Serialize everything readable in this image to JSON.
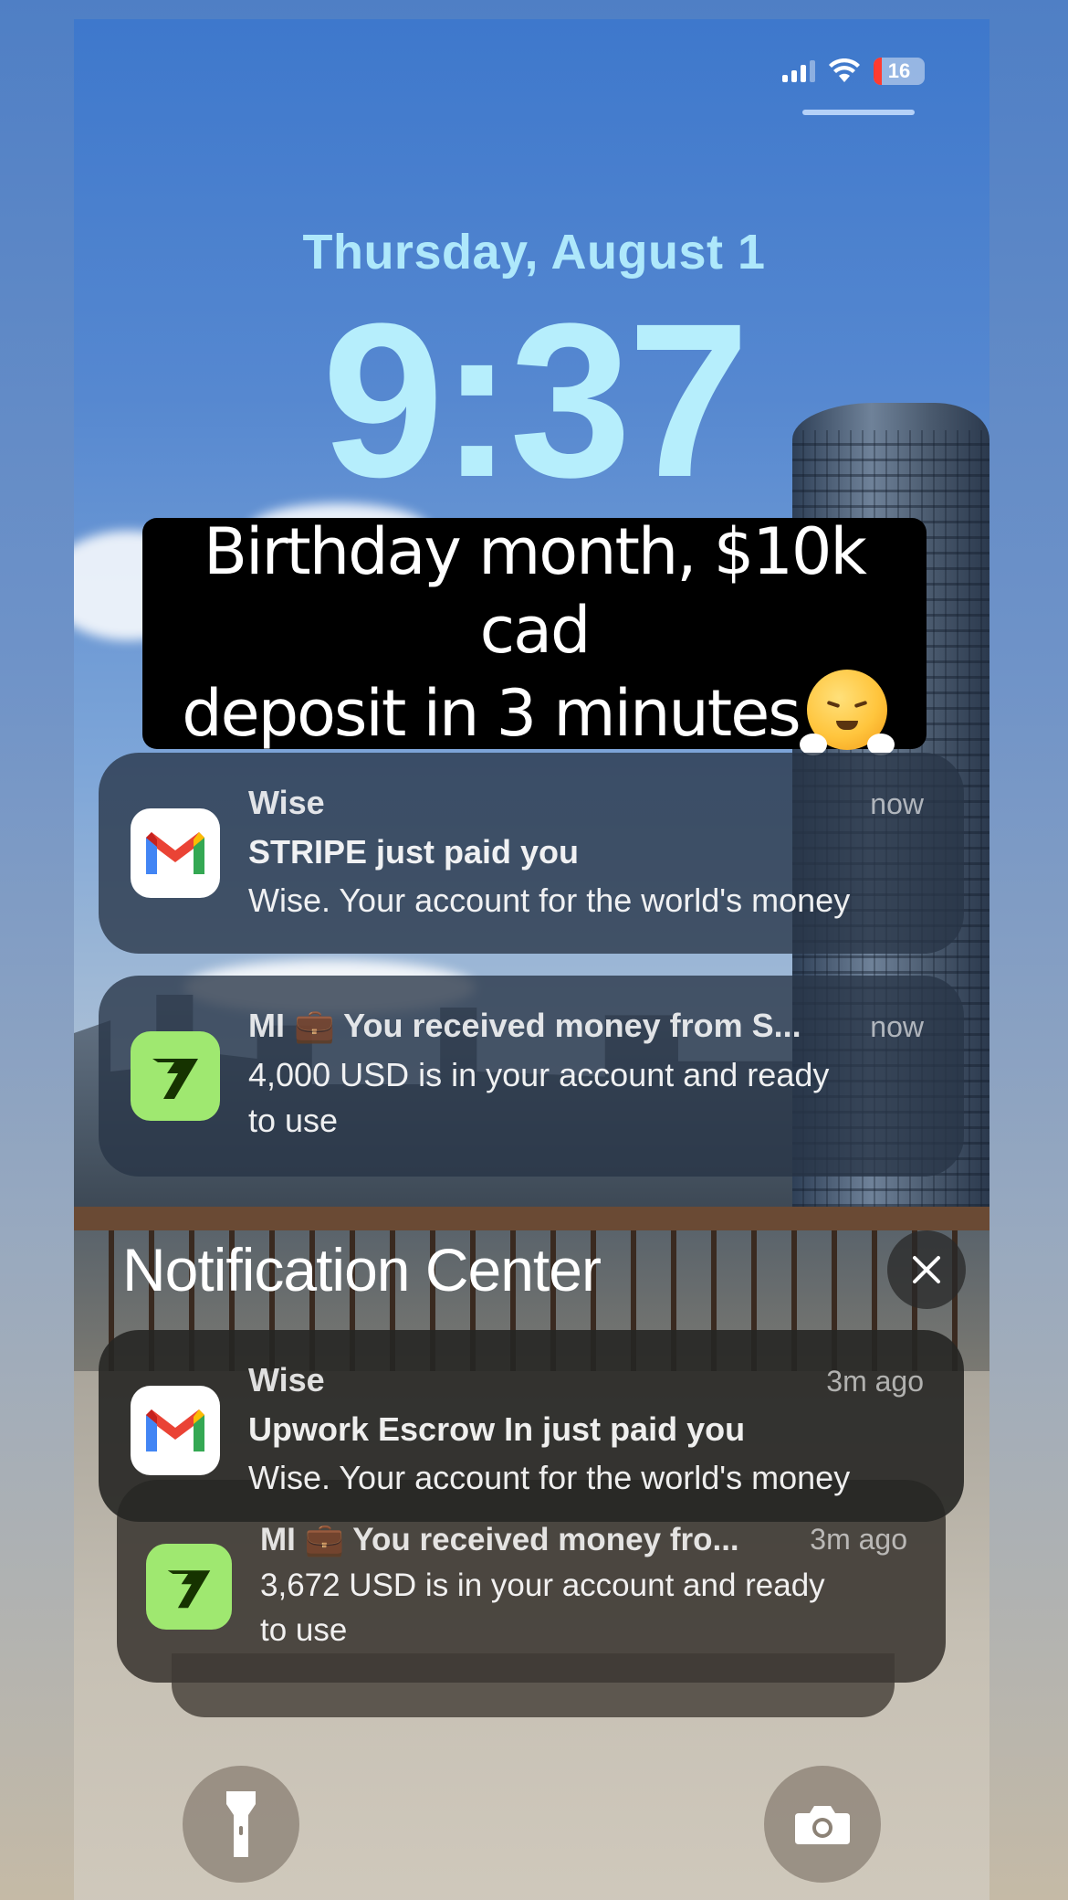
{
  "status_bar": {
    "battery_level": "16",
    "icons": [
      "signal-icon",
      "wifi-icon",
      "battery-icon"
    ]
  },
  "lock_screen": {
    "date": "Thursday, August 1",
    "time": "9:37"
  },
  "caption": {
    "line1": "Birthday month, $10k cad",
    "line2": "deposit in 3 minutes",
    "emoji": "face-with-steam-from-nose"
  },
  "notifications": [
    {
      "app_icon": "gmail-icon",
      "title": "Wise",
      "time": "now",
      "subject": "STRIPE just paid you",
      "body": "Wise. Your account for the world's money"
    },
    {
      "app_icon": "wise-icon",
      "title": "MI 💼 You received money from S...",
      "time": "now",
      "body_line1": "4,000 USD is in your account and ready",
      "body_line2": "to use"
    }
  ],
  "notification_center": {
    "title": "Notification Center",
    "items": [
      {
        "app_icon": "gmail-icon",
        "title": "Wise",
        "time": "3m ago",
        "subject": "Upwork Escrow In just paid you",
        "body": "Wise. Your account for the world's money"
      },
      {
        "app_icon": "wise-icon",
        "title": "MI 💼 You received money fro...",
        "time": "3m ago",
        "body_line1": "3,672 USD is in your account and ready",
        "body_line2": "to use"
      }
    ]
  },
  "quick_actions": [
    "flashlight-icon",
    "camera-icon"
  ],
  "colors": {
    "time_text": "#b6eefc",
    "wise_green": "#9fe870",
    "wise_dark": "#163300",
    "gmail_red": "#ea4335",
    "gmail_blue": "#4285f4",
    "gmail_green": "#34a853",
    "gmail_yellow": "#fbbc04"
  }
}
